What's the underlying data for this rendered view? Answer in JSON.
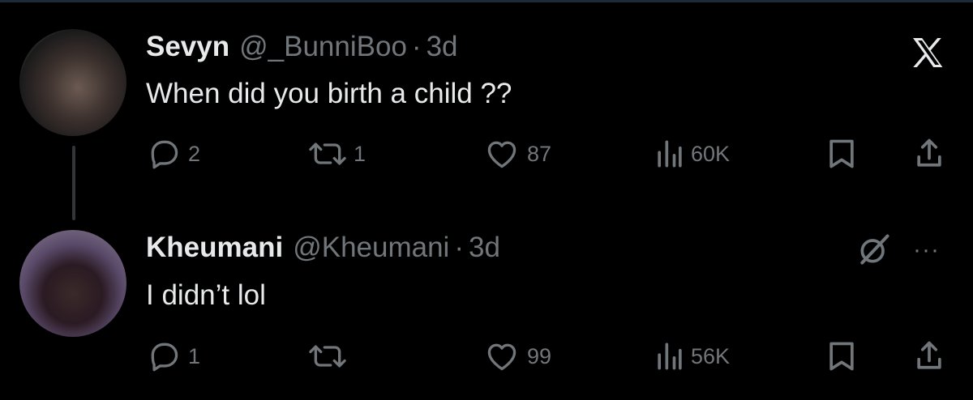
{
  "tweets": [
    {
      "name": "Sevyn",
      "handle": "@_BunniBoo",
      "sep": "·",
      "time": "3d",
      "text": "When did you birth a child ??",
      "replies": "2",
      "reposts": "1",
      "likes": "87",
      "views": "60K"
    },
    {
      "name": "Kheumani",
      "handle": "@Kheumani",
      "sep": "·",
      "time": "3d",
      "text": "I didn’t lol",
      "replies": "1",
      "reposts": "",
      "likes": "99",
      "views": "56K"
    }
  ],
  "icons": {
    "brand": "x-logo-icon",
    "reply": "reply-icon",
    "repost": "repost-icon",
    "like": "heart-icon",
    "views": "views-icon",
    "bookmark": "bookmark-icon",
    "share": "share-icon",
    "grok": "grok-icon",
    "more": "more-icon"
  },
  "more_glyph": "···",
  "colors": {
    "background": "#000000",
    "primary_text": "#e7e9ea",
    "secondary_text": "#71767b",
    "thread_line": "#333639"
  }
}
